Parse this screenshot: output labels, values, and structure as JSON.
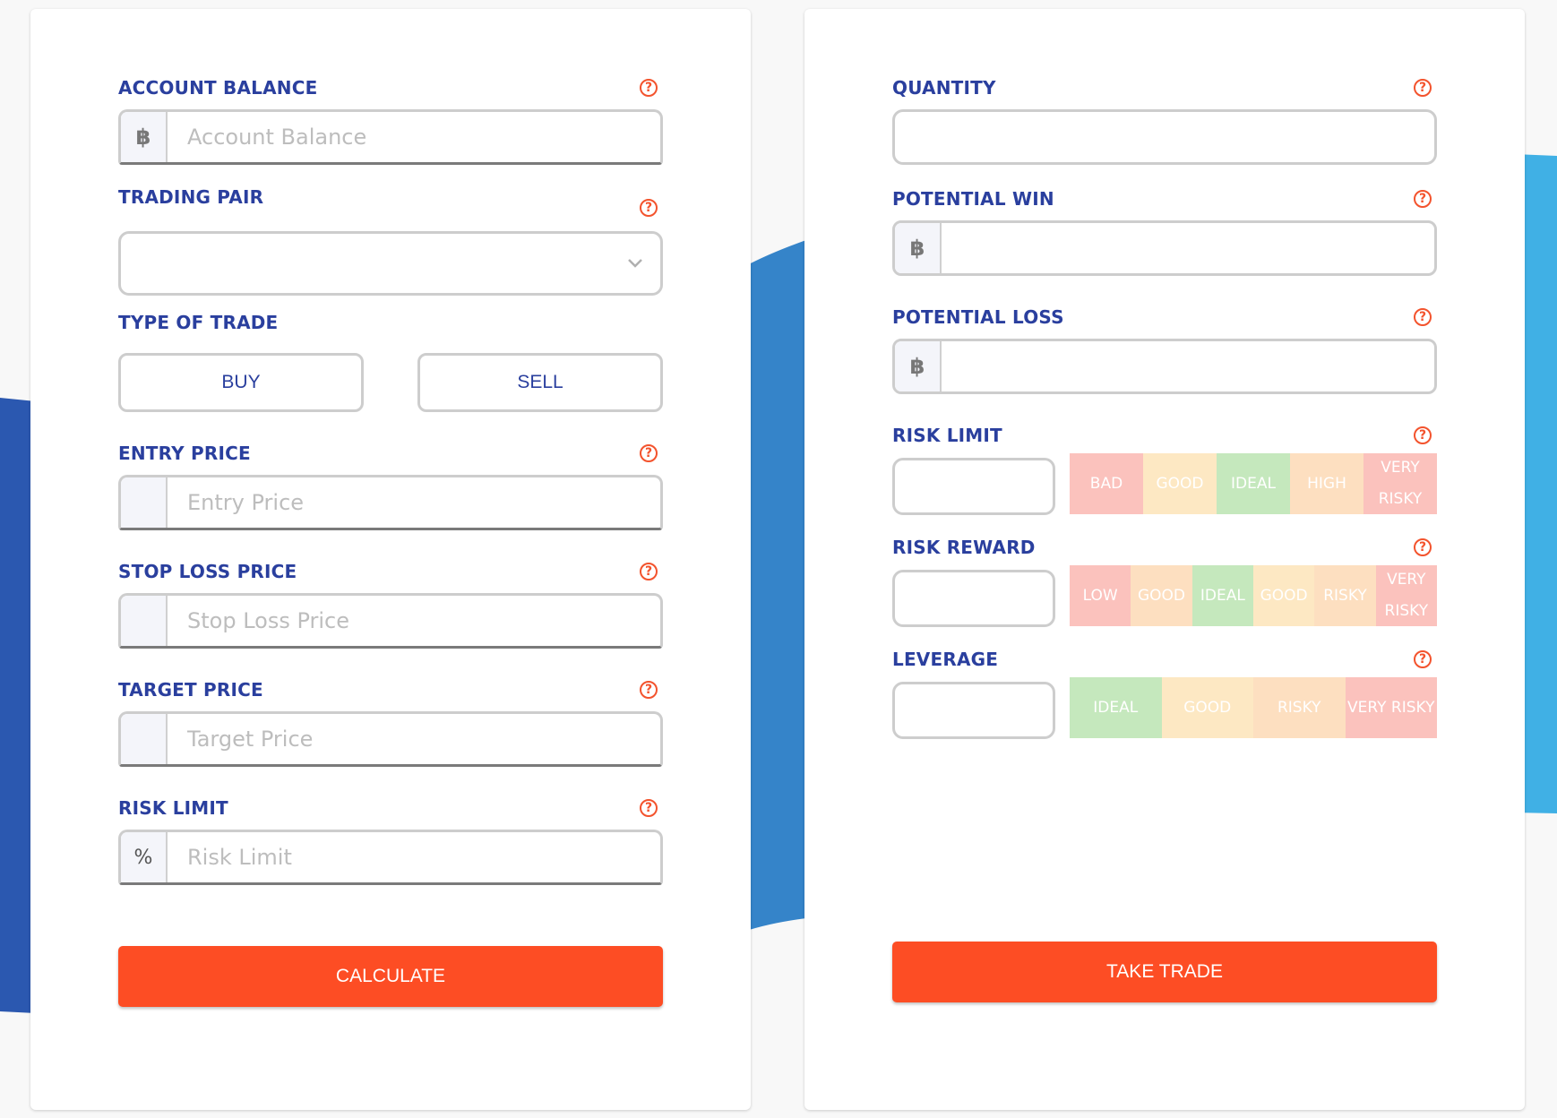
{
  "colors": {
    "label": "#2a3f9e",
    "help_icon": "#f3532d",
    "button": "#fd4d24",
    "blue_dark": "#2b58b0",
    "blue_mid": "#3584c9",
    "blue_light": "#40b0e5",
    "seg_red": "#fbc2bd",
    "seg_yellow": "#fde8c3",
    "seg_green": "#c5e8bd",
    "seg_peach": "#fddfc0"
  },
  "left": {
    "account_balance": {
      "label": "ACCOUNT BALANCE",
      "prefix": "฿",
      "placeholder": "Account Balance",
      "value": ""
    },
    "trading_pair": {
      "label": "TRADING PAIR",
      "selected": ""
    },
    "type_of_trade": {
      "label": "TYPE OF TRADE",
      "buy": "BUY",
      "sell": "SELL"
    },
    "entry_price": {
      "label": "ENTRY PRICE",
      "prefix": "",
      "placeholder": "Entry Price",
      "value": ""
    },
    "stop_loss_price": {
      "label": "STOP LOSS PRICE",
      "prefix": "",
      "placeholder": "Stop Loss Price",
      "value": ""
    },
    "target_price": {
      "label": "TARGET PRICE",
      "prefix": "",
      "placeholder": "Target Price",
      "value": ""
    },
    "risk_limit": {
      "label": "RISK LIMIT",
      "prefix": "%",
      "placeholder": "Risk Limit",
      "value": ""
    },
    "calculate": "CALCULATE"
  },
  "right": {
    "quantity": {
      "label": "QUANTITY",
      "value": ""
    },
    "potential_win": {
      "label": "POTENTIAL WIN",
      "prefix": "฿",
      "value": ""
    },
    "potential_loss": {
      "label": "POTENTIAL LOSS",
      "prefix": "฿",
      "value": ""
    },
    "risk_limit": {
      "label": "RISK LIMIT",
      "value": "",
      "segments": [
        {
          "text": "BAD",
          "color": "#fbc2bd"
        },
        {
          "text": "GOOD",
          "color": "#fde8c3"
        },
        {
          "text": "IDEAL",
          "color": "#c5e8bd"
        },
        {
          "text": "HIGH",
          "color": "#fddfc0"
        },
        {
          "text": "VERY RISKY",
          "color": "#fbc2bd"
        }
      ]
    },
    "risk_reward": {
      "label": "RISK REWARD",
      "value": "",
      "segments": [
        {
          "text": "LOW",
          "color": "#fbc2bd"
        },
        {
          "text": "GOOD",
          "color": "#fddfc0"
        },
        {
          "text": "IDEAL",
          "color": "#c5e8bd"
        },
        {
          "text": "GOOD",
          "color": "#fde8c3"
        },
        {
          "text": "RISKY",
          "color": "#fddfc0"
        },
        {
          "text": "VERY RISKY",
          "color": "#fbc2bd"
        }
      ]
    },
    "leverage": {
      "label": "LEVERAGE",
      "value": "",
      "segments": [
        {
          "text": "IDEAL",
          "color": "#c5e8bd"
        },
        {
          "text": "GOOD",
          "color": "#fde8c3"
        },
        {
          "text": "RISKY",
          "color": "#fddfc0"
        },
        {
          "text": "VERY RISKY",
          "color": "#fbc2bd"
        }
      ]
    },
    "take_trade": "TAKE TRADE"
  },
  "icons": {
    "help": "question-circle-icon",
    "currency": "bitcoin-icon",
    "dropdown": "chevron-down-icon"
  }
}
